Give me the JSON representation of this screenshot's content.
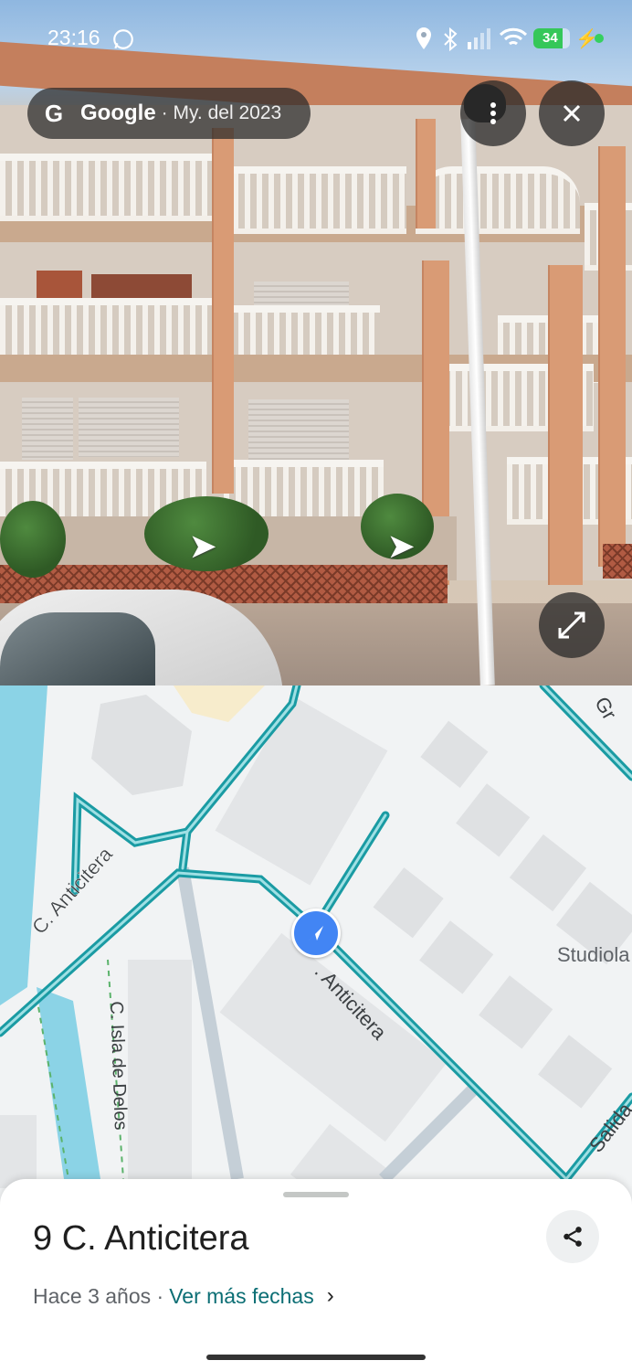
{
  "status_bar": {
    "time": "23:16",
    "battery": "34"
  },
  "streetview": {
    "provider": "Google",
    "date": "· My. del 2023",
    "icons": {
      "menu": "more-vert-icon",
      "close": "close-icon",
      "expand": "expand-icon"
    }
  },
  "map": {
    "labels": {
      "street_main_left": "C. Anticitera",
      "street_main_right": ". Anticitera",
      "street_isla": "C. Isla de Delos",
      "place_studiola": "Studiola",
      "exit": "Salida",
      "top_right": "Gr"
    },
    "colors": {
      "road": "#1a9ba3",
      "water": "#8bd3e6",
      "building": "#dfe1e3",
      "marker": "#4285f4"
    }
  },
  "sheet": {
    "address": "9 C. Anticitera",
    "age": "Hace 3 años ·",
    "more_dates": "Ver más fechas"
  }
}
